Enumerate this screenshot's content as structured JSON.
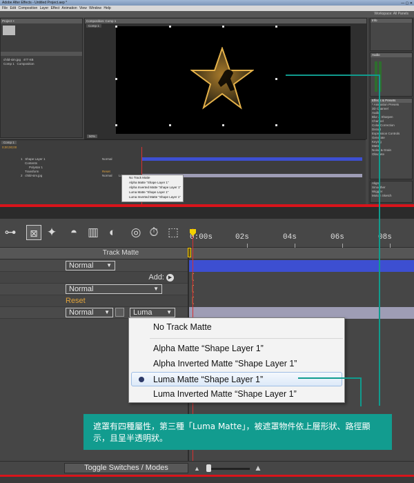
{
  "app": {
    "title": "Adobe After Effects - Untitled Project.aep *",
    "menu": [
      "File",
      "Edit",
      "Composition",
      "Layer",
      "Effect",
      "Animation",
      "View",
      "Window",
      "Help"
    ],
    "workspace_label": "Workspace: All Panels"
  },
  "mini": {
    "project_panel_title": "Project ×",
    "project_items": [
      {
        "name": "child-sim.jpg",
        "size": "477 KB"
      },
      {
        "name": "Comp 1",
        "type": "Composition"
      }
    ],
    "comp_panel_title": "Composition: Comp 1",
    "comp_tab": "Comp 1",
    "zoom_value": "50%",
    "timeline_tab": "Comp 1",
    "timecode": "0;00;00;00",
    "layers": [
      {
        "num": "1",
        "name": "Shape Layer 1",
        "mode": "Normal"
      },
      {
        "name": "Contents"
      },
      {
        "name": "Polystar 1"
      },
      {
        "name": "Transform",
        "action": "Reset"
      },
      {
        "num": "2",
        "name": "child-sim.jpg",
        "mode": "Normal",
        "matte": "Luma"
      }
    ],
    "right_panels": [
      {
        "title": "Info"
      },
      {
        "title": "Audio"
      },
      {
        "title": "Preview"
      },
      {
        "title": "Effects & Presets",
        "items": [
          "* Animation Presets",
          "3D Channel",
          "Audio",
          "Blur & Sharpen",
          "Channel",
          "Color Correction",
          "Distort",
          "Expression Controls",
          "Generate",
          "Keying",
          "Matte",
          "Noise & Grain",
          "Obsolete"
        ]
      },
      {
        "title": "Align"
      },
      {
        "title": "Smoother"
      },
      {
        "title": "Wiggler"
      },
      {
        "title": "Motion Sketch"
      },
      {
        "title": "Mask Interpolation"
      },
      {
        "title": "Paint"
      },
      {
        "title": "Brushes"
      },
      {
        "title": "Paragraph"
      },
      {
        "title": "Character"
      }
    ]
  },
  "timeline": {
    "ruler_labels": [
      "0:00s",
      "02s",
      "04s",
      "06s",
      "08s"
    ],
    "column_header": "Track Matte",
    "rows": [
      {
        "mode": "Normal"
      },
      {
        "add_label": "Add:"
      },
      {
        "mode": "Normal"
      },
      {
        "reset_label": "Reset"
      },
      {
        "mode": "Normal",
        "matte": "Luma"
      }
    ],
    "colors": {
      "track_blue": "#3d4fd1",
      "track_lavender": "#9e9db5",
      "reset_orange": "#e2a43b",
      "playhead_red": "#d93030",
      "accent_teal": "#129c8f"
    }
  },
  "popup": {
    "items": [
      {
        "label": "No Track Matte",
        "selected": false
      },
      {
        "label": "Alpha Matte “Shape Layer 1”",
        "selected": false
      },
      {
        "label": "Alpha Inverted Matte “Shape Layer 1”",
        "selected": false
      },
      {
        "label": "Luma Matte “Shape Layer 1”",
        "selected": true
      },
      {
        "label": "Luma Inverted Matte “Shape Layer 1”",
        "selected": false
      }
    ]
  },
  "bottom": {
    "toggle_label": "Toggle Switches / Modes"
  },
  "annotation": {
    "text": "遮罩有四種屬性，第三種「Luma Matte」，被遮罩物件依上層形狀、路徑顯示，且呈半透明狀。"
  }
}
